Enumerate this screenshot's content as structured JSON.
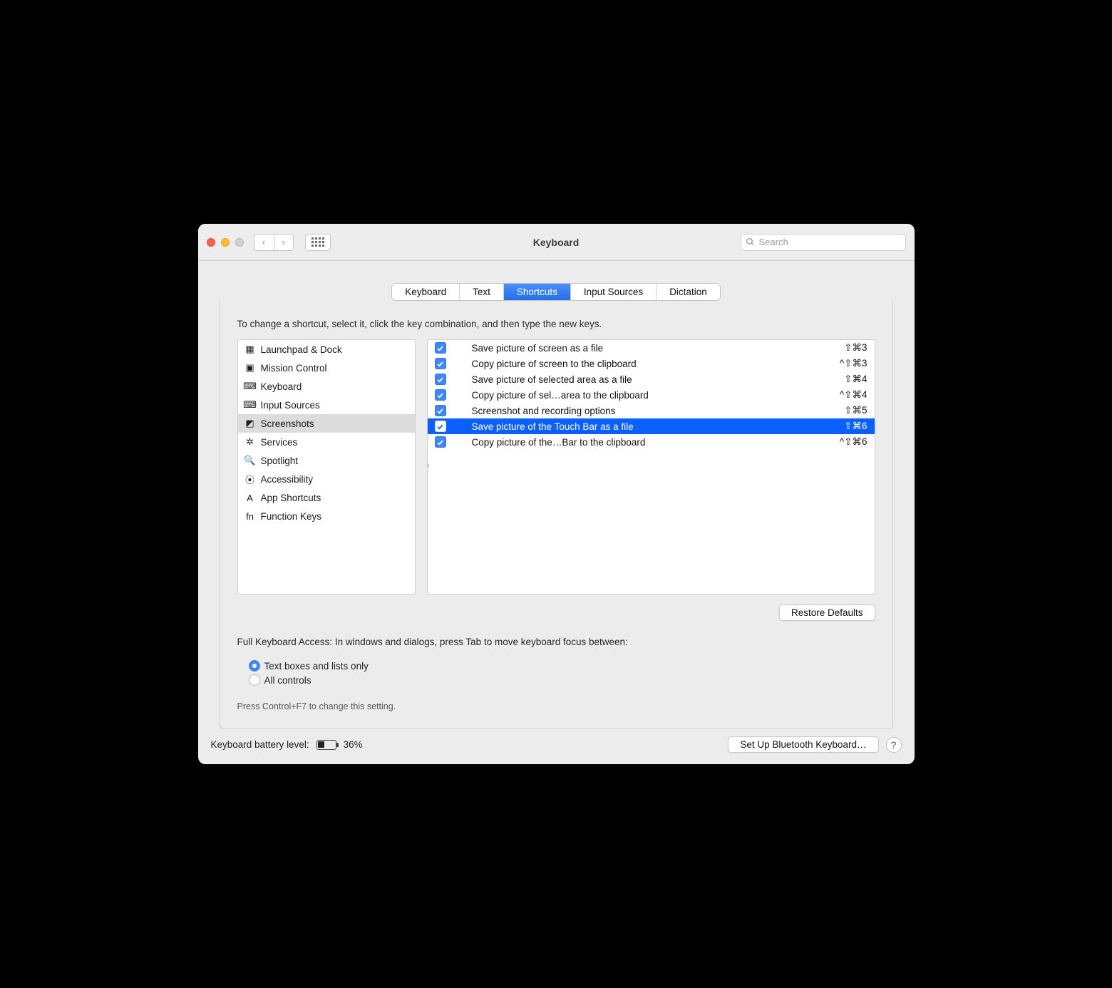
{
  "window": {
    "title": "Keyboard"
  },
  "toolbar": {
    "search_placeholder": "Search"
  },
  "tabs": [
    {
      "label": "Keyboard",
      "active": false
    },
    {
      "label": "Text",
      "active": false
    },
    {
      "label": "Shortcuts",
      "active": true
    },
    {
      "label": "Input Sources",
      "active": false
    },
    {
      "label": "Dictation",
      "active": false
    }
  ],
  "instruction": "To change a shortcut, select it, click the key combination, and then type the new keys.",
  "categories": [
    {
      "icon": "launchpad-icon",
      "glyph": "▦",
      "label": "Launchpad & Dock",
      "selected": false
    },
    {
      "icon": "mission-control-icon",
      "glyph": "▣",
      "label": "Mission Control",
      "selected": false
    },
    {
      "icon": "keyboard-icon",
      "glyph": "⌨",
      "label": "Keyboard",
      "selected": false
    },
    {
      "icon": "input-sources-icon",
      "glyph": "⌨",
      "label": "Input Sources",
      "selected": false
    },
    {
      "icon": "screenshots-icon",
      "glyph": "◩",
      "label": "Screenshots",
      "selected": true
    },
    {
      "icon": "services-icon",
      "glyph": "✲",
      "label": "Services",
      "selected": false
    },
    {
      "icon": "spotlight-icon",
      "glyph": "🔍",
      "label": "Spotlight",
      "selected": false
    },
    {
      "icon": "accessibility-icon",
      "glyph": "⦿",
      "label": "Accessibility",
      "selected": false
    },
    {
      "icon": "app-shortcuts-icon",
      "glyph": "A",
      "label": "App Shortcuts",
      "selected": false
    },
    {
      "icon": "function-keys-icon",
      "glyph": "fn",
      "label": "Function Keys",
      "selected": false
    }
  ],
  "shortcuts": [
    {
      "checked": true,
      "label": "Save picture of screen as a file",
      "keys": "⇧⌘3",
      "selected": false
    },
    {
      "checked": true,
      "label": "Copy picture of screen to the clipboard",
      "keys": "^⇧⌘3",
      "selected": false
    },
    {
      "checked": true,
      "label": "Save picture of selected area as a file",
      "keys": "⇧⌘4",
      "selected": false
    },
    {
      "checked": true,
      "label": "Copy picture of sel…area to the clipboard",
      "keys": "^⇧⌘4",
      "selected": false
    },
    {
      "checked": true,
      "label": "Screenshot and recording options",
      "keys": "⇧⌘5",
      "selected": false
    },
    {
      "checked": true,
      "label": "Save picture of the Touch Bar as a file",
      "keys": "⇧⌘6",
      "selected": true
    },
    {
      "checked": true,
      "label": "Copy picture of the…Bar to the clipboard",
      "keys": "^⇧⌘6",
      "selected": false
    }
  ],
  "restore_label": "Restore Defaults",
  "fka": {
    "heading": "Full Keyboard Access: In windows and dialogs, press Tab to move keyboard focus between:",
    "options": [
      {
        "label": "Text boxes and lists only",
        "selected": true
      },
      {
        "label": "All controls",
        "selected": false
      }
    ],
    "hint": "Press Control+F7 to change this setting."
  },
  "footer": {
    "battery_label": "Keyboard battery level:",
    "battery_pct": "36%",
    "bluetooth_btn": "Set Up Bluetooth Keyboard…",
    "help": "?"
  }
}
